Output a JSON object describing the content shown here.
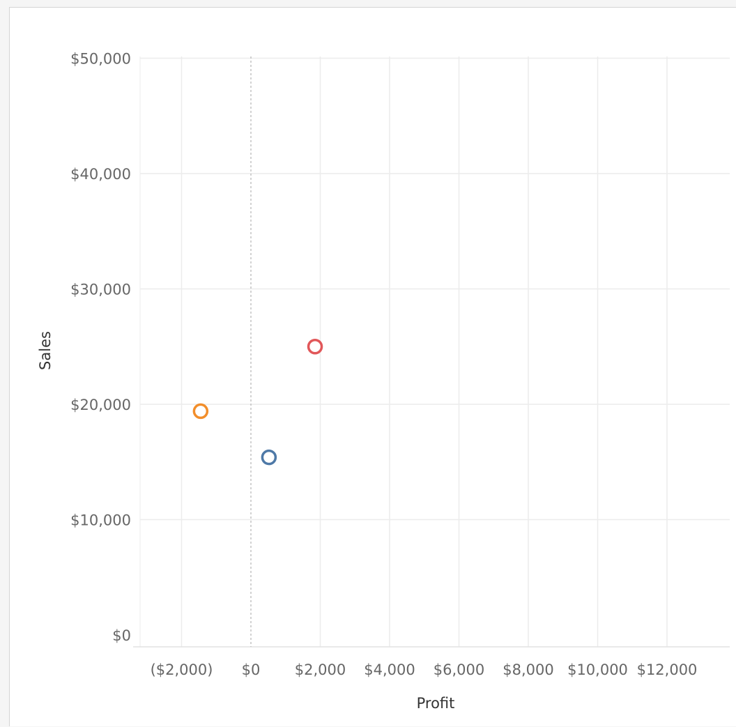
{
  "chart_data": {
    "type": "scatter",
    "xlabel": "Profit",
    "ylabel": "Sales",
    "xlim": [
      -3000,
      14000
    ],
    "ylim": [
      -1000,
      51000
    ],
    "x_ticks": [
      {
        "value": -2000,
        "label": "($2,000)"
      },
      {
        "value": 0,
        "label": "$0"
      },
      {
        "value": 2000,
        "label": "$2,000"
      },
      {
        "value": 4000,
        "label": "$4,000"
      },
      {
        "value": 6000,
        "label": "$6,000"
      },
      {
        "value": 8000,
        "label": "$8,000"
      },
      {
        "value": 10000,
        "label": "$10,000"
      },
      {
        "value": 12000,
        "label": "$12,000"
      }
    ],
    "y_ticks": [
      {
        "value": 0,
        "label": "$0"
      },
      {
        "value": 10000,
        "label": "$10,000"
      },
      {
        "value": 20000,
        "label": "$20,000"
      },
      {
        "value": 30000,
        "label": "$30,000"
      },
      {
        "value": 40000,
        "label": "$40,000"
      },
      {
        "value": 50000,
        "label": "$50,000"
      }
    ],
    "grid": true,
    "zero_line_x": 0,
    "points": [
      {
        "x": 1850,
        "y": 25000,
        "color": "#e15759"
      },
      {
        "x": -1450,
        "y": 19400,
        "color": "#f28e2b"
      },
      {
        "x": 520,
        "y": 15400,
        "color": "#4e79a7"
      }
    ]
  }
}
